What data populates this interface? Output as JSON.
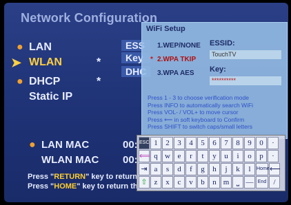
{
  "window": {
    "title": "Network Configuration"
  },
  "menu": {
    "items": [
      {
        "label": "LAN",
        "marker": "●"
      },
      {
        "label": "WLAN",
        "marker": "➤",
        "star": "*"
      },
      {
        "label": "DHCP",
        "marker": "●",
        "star": "*"
      },
      {
        "label": "Static IP",
        "marker": ""
      }
    ]
  },
  "right_column": {
    "essid_partial": "ESS",
    "key_partial": "Key",
    "dhcp_partial": "DHC"
  },
  "mac": {
    "lan_label": "LAN MAC",
    "lan_value": "00:1",
    "wlan_label": "WLAN MAC",
    "wlan_value": "00:0"
  },
  "footer": {
    "line1_prefix": "Press \"",
    "line1_key": "RETURN",
    "line1_suffix": "\" key to return",
    "line2_prefix": "Press \"",
    "line2_key": "HOME",
    "line2_suffix": "\" key to return th"
  },
  "dialog": {
    "title": "WiFi Setup",
    "options": [
      "1.WEP/NONE",
      "2.WPA TKIP",
      "3.WPA AES"
    ],
    "selected_marker": "*",
    "essid_label": "ESSID:",
    "essid_value": "TouchTV",
    "key_label": "Key:",
    "key_value": "**********",
    "hints": [
      "Press 1 - 3 to choose verification mode",
      "Press INFO to automatically search WiFi",
      "Press VOL- / VOL+ to move cursor",
      "Press ⟵ in soft keyboard to Confirm",
      "Press SHIFT to switch caps/small letters"
    ]
  },
  "keyboard": {
    "row1": [
      "ESC",
      "1",
      "2",
      "3",
      "4",
      "5",
      "6",
      "7",
      "8",
      "9",
      "0",
      "·"
    ],
    "row2": [
      "⟸",
      "q",
      "w",
      "e",
      "r",
      "t",
      "y",
      "u",
      "i",
      "o",
      "p",
      "·"
    ],
    "row3": [
      "⇥",
      "a",
      "s",
      "d",
      "f",
      "g",
      "h",
      "j",
      "k",
      "l",
      "Home",
      "⟵"
    ],
    "row4": [
      "⇧",
      "z",
      "x",
      "c",
      "v",
      "b",
      "n",
      "m",
      "⎵",
      "—",
      "End",
      "/"
    ]
  }
}
